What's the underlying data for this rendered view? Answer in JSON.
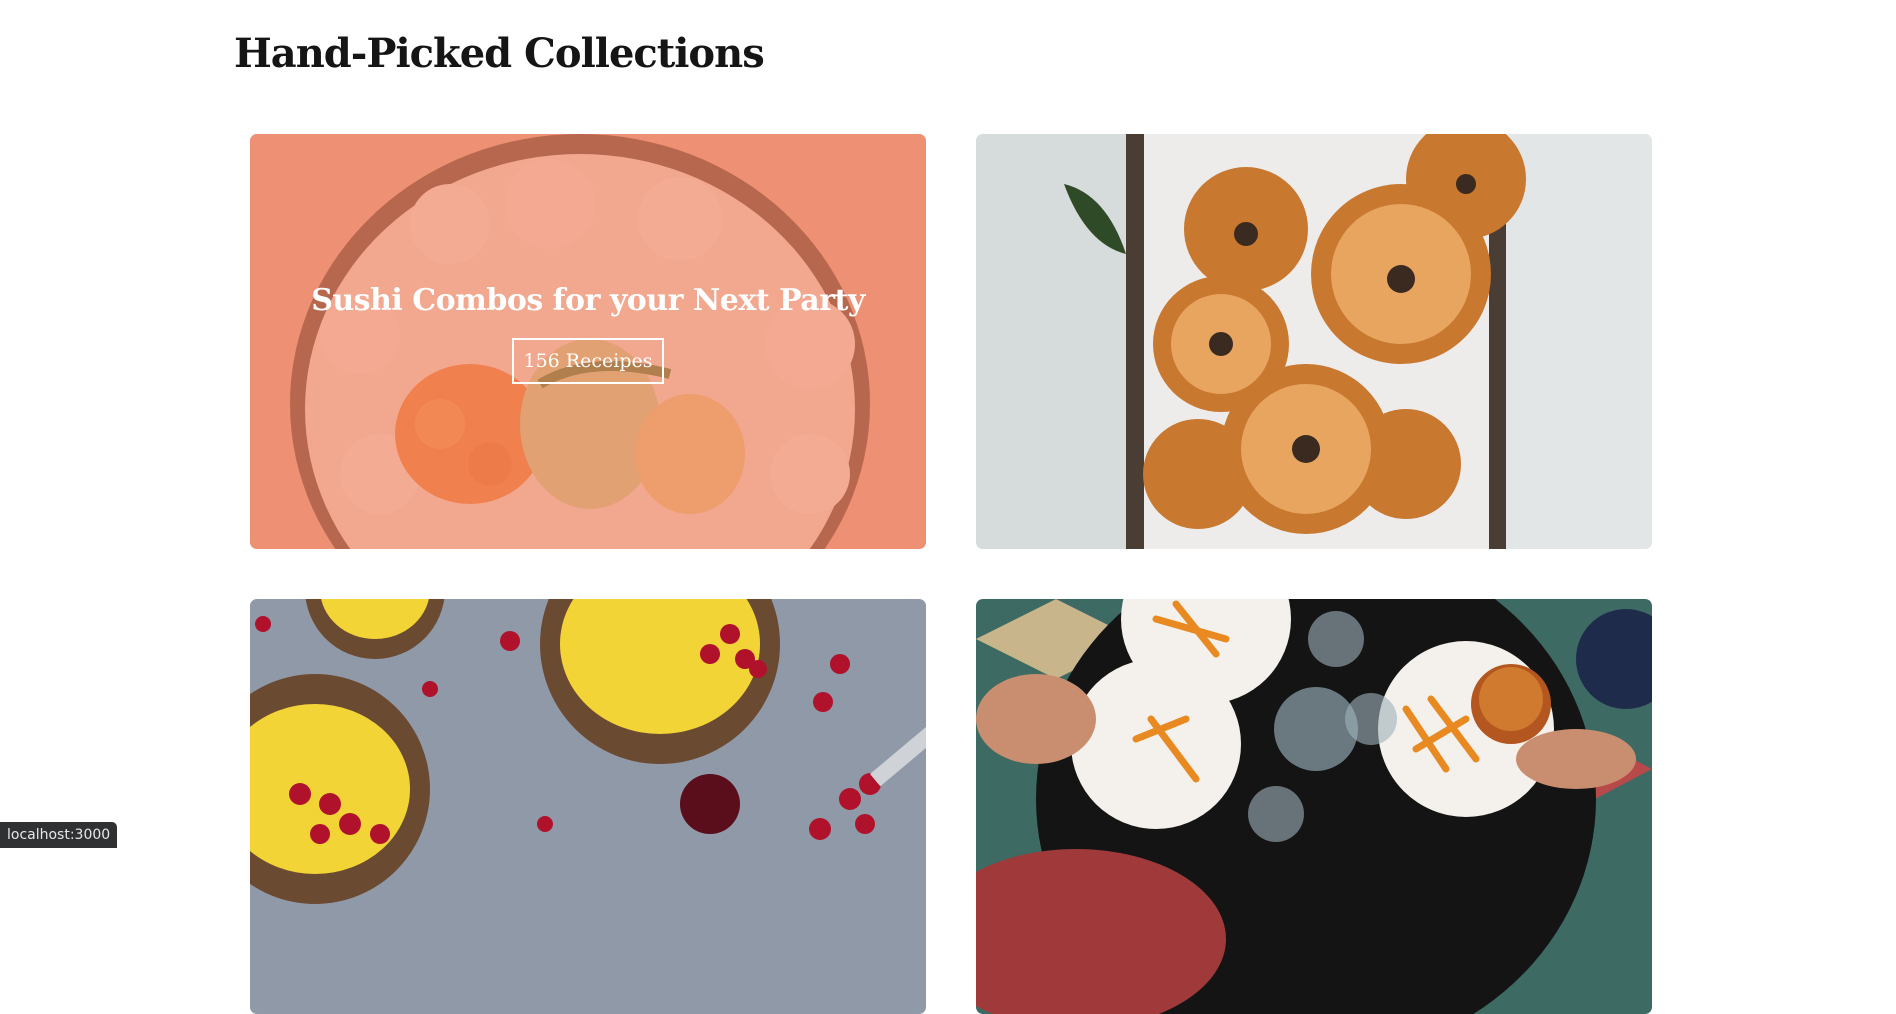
{
  "header": {
    "title": "Hand-Picked Collections"
  },
  "collections": [
    {
      "title": "Sushi Combos for your Next Party",
      "recipes_label": "156 Receipes",
      "image": "sushi-roll"
    },
    {
      "image": "bagels-basket"
    },
    {
      "image": "lemon-tarts-with-berries"
    },
    {
      "image": "burgers-and-fries-table"
    }
  ],
  "status_bar": {
    "url": "localhost:3000"
  },
  "colors": {
    "overlay": "#f08264",
    "title_text": "#151515",
    "card_text": "#ffffff"
  }
}
